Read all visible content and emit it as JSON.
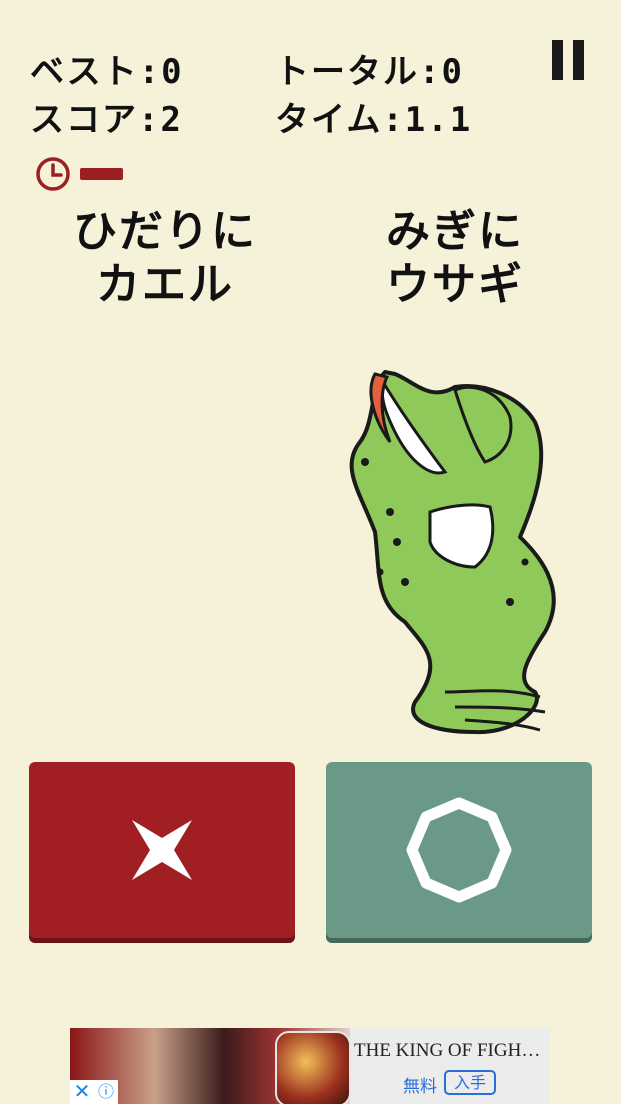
{
  "hud": {
    "best": "ベスト:0",
    "total": "トータル:0",
    "score": "スコア:2",
    "time": "タイム:1.1",
    "pause_icon": "pause-icon",
    "clock_icon": "clock-icon",
    "timer_remaining": 0.25
  },
  "rules": {
    "left": "ひだりに\nカエル",
    "right": "みぎに\nウサギ"
  },
  "character": {
    "name": "frog",
    "side": "right"
  },
  "buttons": {
    "no_icon": "cross-icon",
    "yes_icon": "circle-icon",
    "colors": {
      "no": "#a11f22",
      "yes": "#6a9a87"
    }
  },
  "ad": {
    "title": "THE KING OF FIGHT…",
    "price": "無料",
    "cta": "入手"
  },
  "colors": {
    "background": "#f5f2d9",
    "accent": "#9c1f21",
    "frog": "#8ec95a"
  }
}
